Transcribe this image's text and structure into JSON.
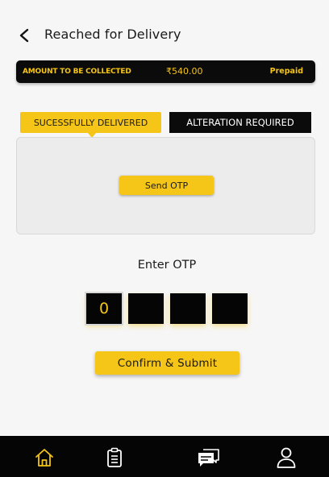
{
  "header": {
    "back_icon": "chevron-left-icon",
    "title": "Reached for Delivery"
  },
  "amount_bar": {
    "label": "AMOUNT TO  BE COLLECTED",
    "amount": "₹540.00",
    "payment_type": "Prepaid"
  },
  "tabs": [
    {
      "label": "SUCESSFULLY DELIVERED",
      "active": true
    },
    {
      "label": "ALTERATION REQUIRED",
      "active": false
    }
  ],
  "otp_card": {
    "send_otp_label": "Send OTP"
  },
  "otp": {
    "label": "Enter OTP",
    "digits": [
      "0",
      "",
      "",
      ""
    ]
  },
  "confirm_label": "Confirm  & Submit",
  "bottom_nav": [
    {
      "icon": "home-icon",
      "active": true
    },
    {
      "icon": "clipboard-icon",
      "active": false
    },
    {
      "icon": "chat-icon",
      "active": false
    },
    {
      "icon": "user-icon",
      "active": false
    }
  ],
  "colors": {
    "accent": "#f5c518",
    "dark": "#0b0b0b",
    "background": "#f6f6f6"
  }
}
